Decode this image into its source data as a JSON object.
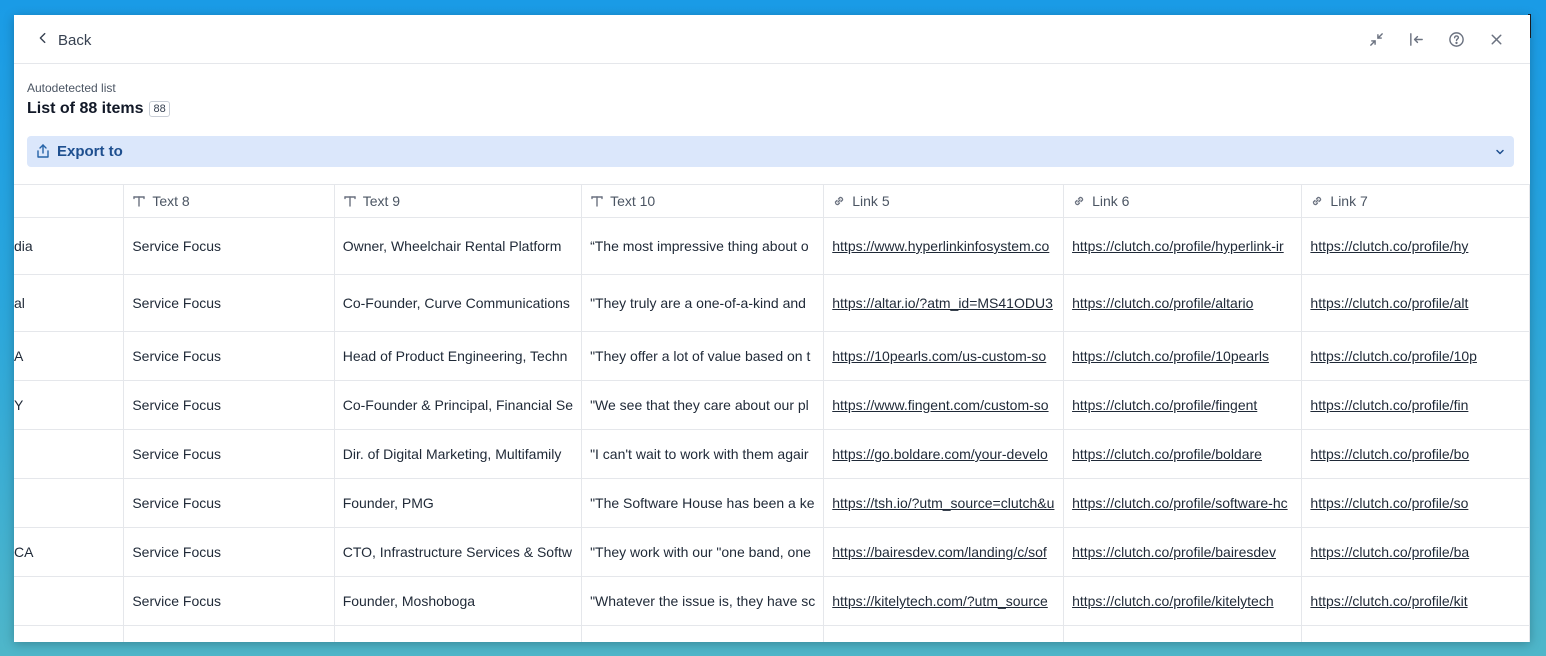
{
  "header": {
    "back_label": "Back",
    "icons": [
      "collapse-icon",
      "dock-left-icon",
      "help-icon",
      "close-icon"
    ]
  },
  "list": {
    "sublabel": "Autodetected list",
    "title": "List of 88 items",
    "count": "88"
  },
  "export": {
    "label": "Export to"
  },
  "table": {
    "columns": [
      {
        "label": "",
        "type": "text"
      },
      {
        "label": "Text 8",
        "type": "text"
      },
      {
        "label": "Text 9",
        "type": "text"
      },
      {
        "label": "Text 10",
        "type": "text"
      },
      {
        "label": "Link 5",
        "type": "link"
      },
      {
        "label": "Link 6",
        "type": "link"
      },
      {
        "label": "Link 7",
        "type": "link"
      }
    ],
    "rows": [
      [
        "dia",
        "Service Focus",
        "Owner, Wheelchair Rental Platform",
        "“The most impressive thing about o",
        "https://www.hyperlinkinfosystem.co",
        "https://clutch.co/profile/hyperlink-ir",
        "https://clutch.co/profile/hy"
      ],
      [
        "al",
        "Service Focus",
        "Co-Founder, Curve Communications",
        "\"They truly are a one-of-a-kind and",
        "https://altar.io/?atm_id=MS41ODU3",
        "https://clutch.co/profile/altario",
        "https://clutch.co/profile/alt"
      ],
      [
        "A",
        "Service Focus",
        "Head of Product Engineering, Techn",
        "\"They offer a lot of value based on t",
        "https://10pearls.com/us-custom-so",
        "https://clutch.co/profile/10pearls",
        "https://clutch.co/profile/10p"
      ],
      [
        "Y",
        "Service Focus",
        "Co-Founder & Principal, Financial Se",
        "\"We see that they care about our pl",
        "https://www.fingent.com/custom-so",
        "https://clutch.co/profile/fingent",
        "https://clutch.co/profile/fin"
      ],
      [
        "",
        "Service Focus",
        "Dir. of Digital Marketing, Multifamily",
        "\"I can't wait to work with them agair",
        "https://go.boldare.com/your-develo",
        "https://clutch.co/profile/boldare",
        "https://clutch.co/profile/bo"
      ],
      [
        "",
        "Service Focus",
        "Founder, PMG",
        "\"The Software House has been a ke",
        "https://tsh.io/?utm_source=clutch&u",
        "https://clutch.co/profile/software-hc",
        "https://clutch.co/profile/so"
      ],
      [
        "CA",
        "Service Focus",
        "CTO, Infrastructure Services & Softw",
        "\"They work with our \"one band, one",
        "https://bairesdev.com/landing/c/sof",
        "https://clutch.co/profile/bairesdev",
        "https://clutch.co/profile/ba"
      ],
      [
        "",
        "Service Focus",
        "Founder, Moshoboga",
        "\"Whatever the issue is, they have sc",
        "https://kitelytech.com/?utm_source",
        "https://clutch.co/profile/kitelytech",
        "https://clutch.co/profile/kit"
      ],
      [
        "",
        "",
        "",
        "",
        "",
        "",
        ""
      ]
    ]
  }
}
